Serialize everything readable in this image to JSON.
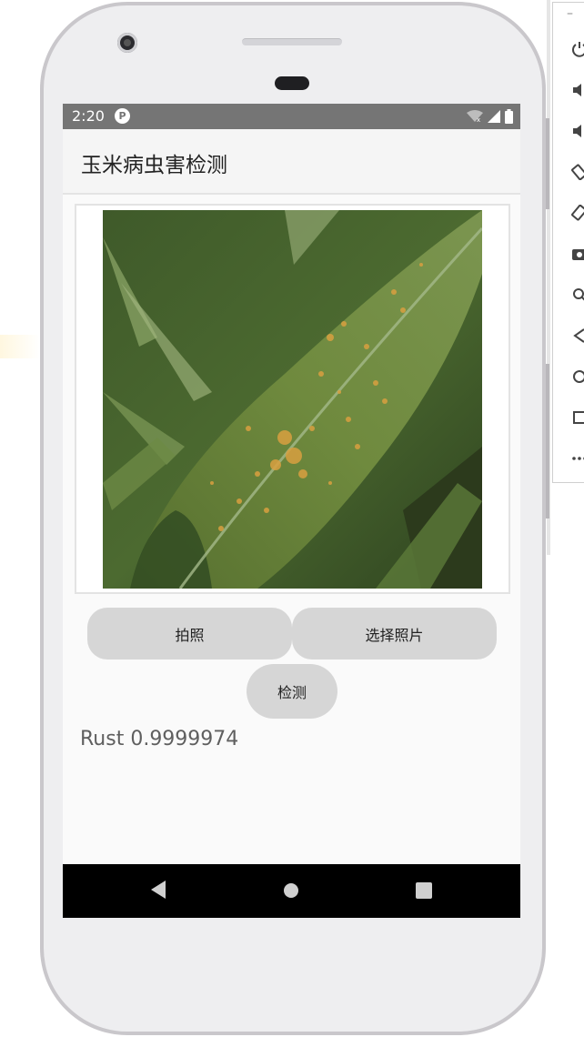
{
  "status_bar": {
    "time": "2:20",
    "badge": "P"
  },
  "app": {
    "title": "玉米病虫害检测"
  },
  "buttons": {
    "take_photo": "拍照",
    "select_photo": "选择照片",
    "detect": "检测"
  },
  "result": {
    "text": "Rust 0.9999974"
  },
  "navigation": {
    "icons": [
      "back-icon",
      "home-icon",
      "recents-icon"
    ]
  },
  "emulator_toolbar": {
    "minimize": "–",
    "icons": [
      "power-icon",
      "volume-up-icon",
      "volume-down-icon",
      "rotate-left-icon",
      "rotate-right-icon",
      "camera-icon",
      "zoom-icon",
      "back-icon",
      "home-icon",
      "overview-icon",
      "more-icon"
    ]
  },
  "colors": {
    "status_bar": "#757575",
    "app_bar": "#f5f5f5",
    "button": "#d6d6d6",
    "nav_bar": "#000000"
  }
}
